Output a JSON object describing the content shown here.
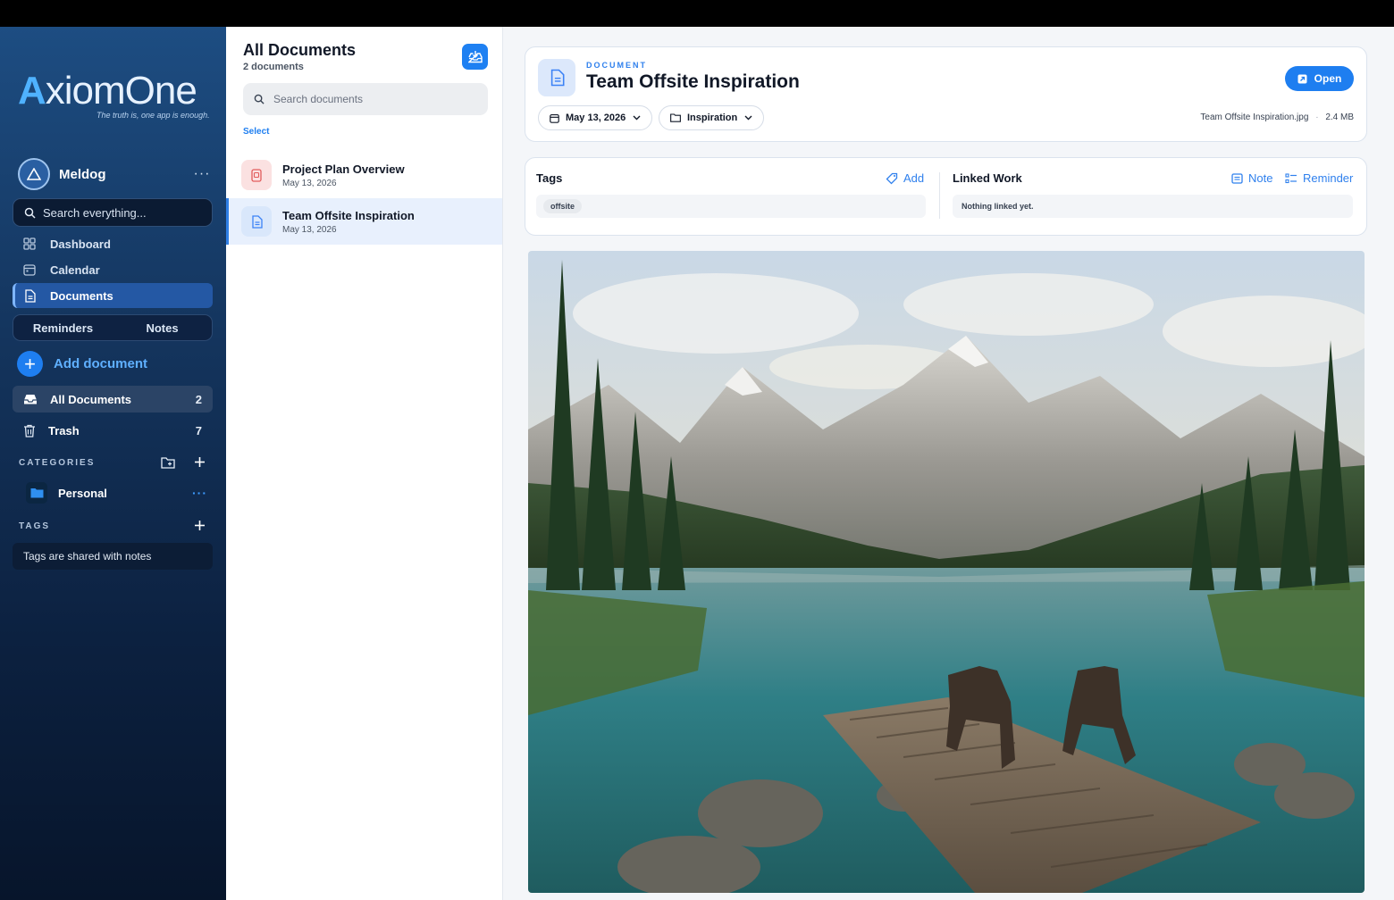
{
  "app": {
    "brand_first": "A",
    "brand_rest": "xiomOne",
    "tagline": "The truth is, one app is enough."
  },
  "profile": {
    "name": "Meldog",
    "menu": "···"
  },
  "sidebar": {
    "search_placeholder": "Search everything...",
    "nav": [
      {
        "label": "Dashboard",
        "icon": "grid-icon"
      },
      {
        "label": "Calendar",
        "icon": "calendar-icon"
      },
      {
        "label": "Documents",
        "icon": "document-icon",
        "active": true
      }
    ],
    "segments": [
      "Reminders",
      "Notes"
    ],
    "add_document": "Add document",
    "all_documents": {
      "label": "All Documents",
      "count": "2"
    },
    "trash": {
      "label": "Trash",
      "count": "7"
    },
    "categories_title": "CATEGORIES",
    "categories": [
      {
        "label": "Personal",
        "more": "···"
      }
    ],
    "tags_title": "TAGS",
    "tags_note": "Tags are shared with notes"
  },
  "list": {
    "title": "All Documents",
    "subtitle": "2 documents",
    "search_placeholder": "Search documents",
    "select_label": "Select",
    "items": [
      {
        "name": "Project Plan Overview",
        "date": "May 13, 2026",
        "color": "#e25c5c"
      },
      {
        "name": "Team Offsite Inspiration",
        "date": "May 13, 2026",
        "color": "#3b82f6",
        "selected": true
      }
    ]
  },
  "detail": {
    "eyebrow": "DOCUMENT",
    "title": "Team Offsite Inspiration",
    "open_label": "Open",
    "date": "May 13, 2026",
    "category": "Inspiration",
    "file_name": "Team Offsite Inspiration.jpg",
    "separator": "·",
    "file_size": "2.4 MB",
    "tags_title": "Tags",
    "add_tag": "Add",
    "tags": [
      "offsite"
    ],
    "linked_title": "Linked Work",
    "note_action": "Note",
    "reminder_action": "Reminder",
    "linked_empty": "Nothing linked yet."
  },
  "colors": {
    "accent": "#1e7ef0",
    "sidebar_top": "#1d4d82",
    "sidebar_bottom": "#07152b"
  }
}
